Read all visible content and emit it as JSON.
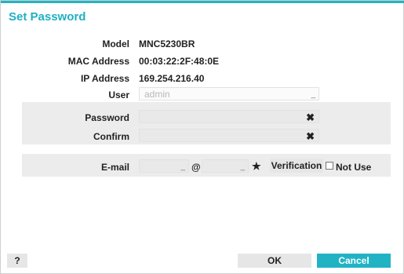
{
  "dialog": {
    "title": "Set Password",
    "accent_color": "#21b3c4"
  },
  "info": {
    "model_label": "Model",
    "model_value": "MNC5230BR",
    "mac_label": "MAC Address",
    "mac_value": "00:03:22:2F:48:0E",
    "ip_label": "IP Address",
    "ip_value": "169.254.216.40",
    "user_label": "User",
    "user_placeholder": "admin"
  },
  "password": {
    "password_label": "Password",
    "confirm_label": "Confirm",
    "clear_icon": "✖"
  },
  "email": {
    "label": "E-mail",
    "at_symbol": "@",
    "star_icon": "★",
    "verification_label": "Verification",
    "not_use_label": "Not Use"
  },
  "footer": {
    "help_label": "?",
    "ok_label": "OK",
    "cancel_label": "Cancel"
  }
}
